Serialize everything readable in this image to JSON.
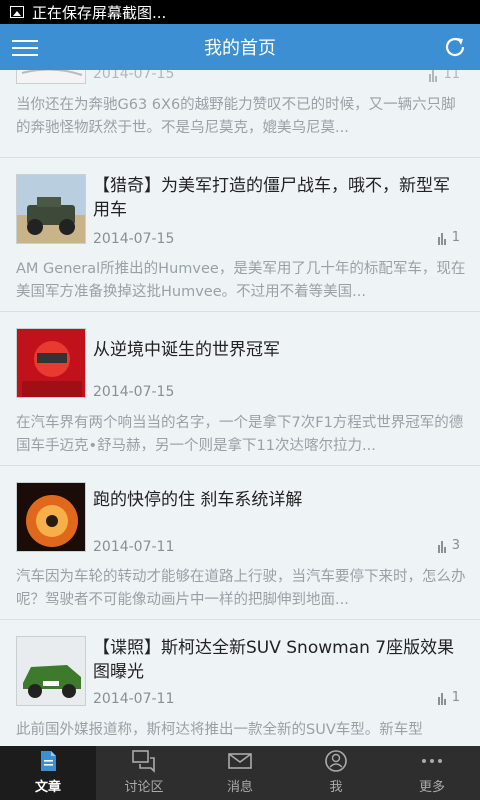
{
  "status_bar": {
    "text": "正在保存屏幕截图..."
  },
  "app_bar": {
    "title": "我的首页"
  },
  "articles": [
    {
      "title": "",
      "date": "2014-07-15",
      "views": "11",
      "summary": "当你还在为奔驰G63 6X6的越野能力赞叹不已的时候，又一辆六只脚的奔驰怪物跃然于世。不是乌尼莫克，媲美乌尼莫..."
    },
    {
      "title": "【猎奇】为美军打造的僵尸战车，哦不，新型军用车",
      "date": "2014-07-15",
      "views": "1",
      "summary": "AM General所推出的Humvee，是美军用了几十年的标配军车，现在美国军方准备换掉这批Humvee。不过用不着等美国..."
    },
    {
      "title": "从逆境中诞生的世界冠军",
      "date": "2014-07-15",
      "views": "",
      "summary": "在汽车界有两个响当当的名字，一个是拿下7次F1方程式世界冠军的德国车手迈克•舒马赫，另一个则是拿下11次达喀尔拉力..."
    },
    {
      "title": "跑的快停的住 刹车系统详解",
      "date": "2014-07-11",
      "views": "3",
      "summary": "汽车因为车轮的转动才能够在道路上行驶，当汽车要停下来时，怎么办呢？驾驶者不可能像动画片中一样的把脚伸到地面..."
    },
    {
      "title": "【谍照】斯柯达全新SUV Snowman 7座版效果图曝光",
      "date": "2014-07-11",
      "views": "1",
      "summary": "此前国外媒报道称，斯柯达将推出一款全新的SUV车型。新车型"
    }
  ],
  "tabs": [
    {
      "label": "文章",
      "icon": "article-icon",
      "active": true
    },
    {
      "label": "讨论区",
      "icon": "discussion-icon",
      "active": false
    },
    {
      "label": "消息",
      "icon": "message-icon",
      "active": false
    },
    {
      "label": "我",
      "icon": "profile-icon",
      "active": false
    },
    {
      "label": "更多",
      "icon": "more-icon",
      "active": false
    }
  ],
  "colors": {
    "app_bar": "#3d8fd4",
    "tab_bar": "#2e2e2e",
    "active_tab_icon": "#3d8fd4"
  }
}
